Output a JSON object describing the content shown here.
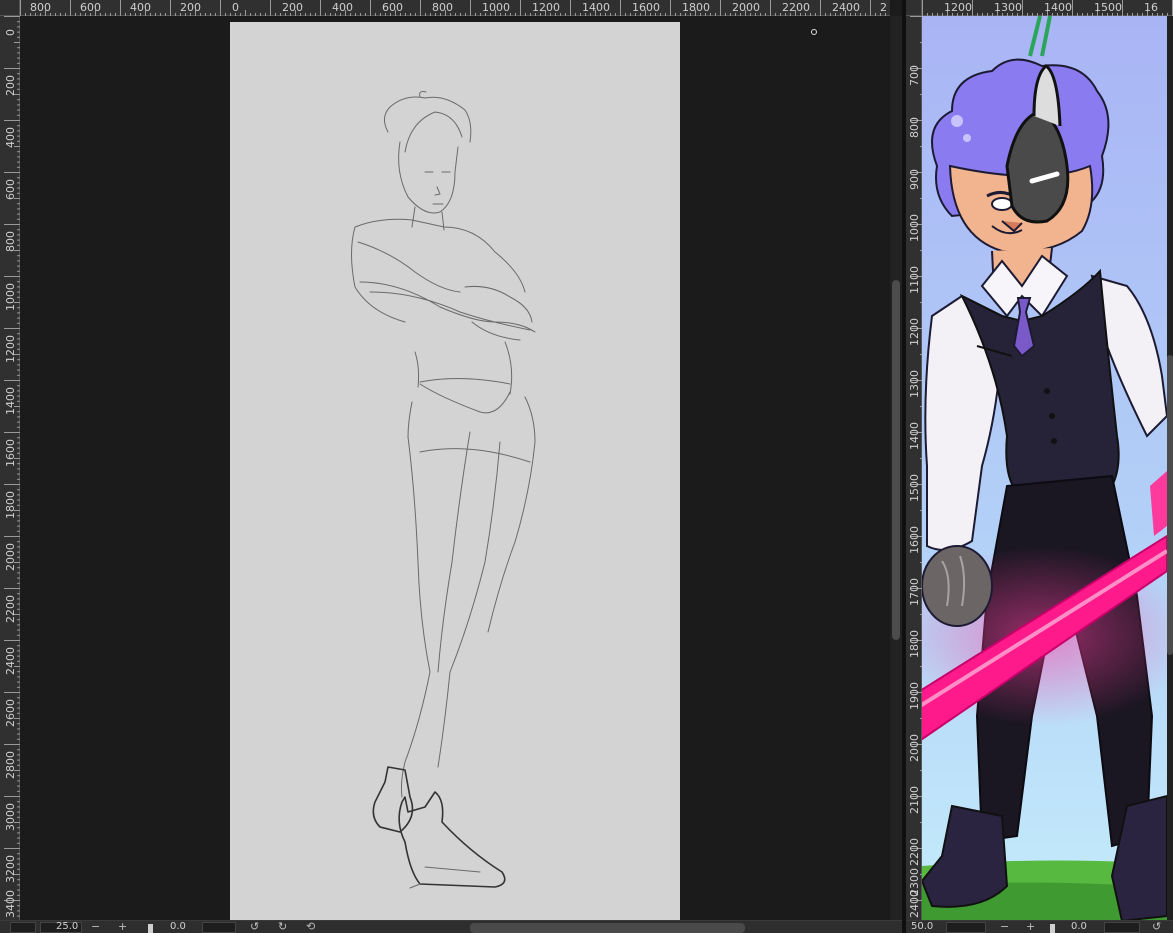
{
  "left_view": {
    "ruler_h_labels": [
      "800",
      "600",
      "400",
      "200",
      "0",
      "200",
      "400",
      "600",
      "800",
      "1000",
      "1200",
      "1400",
      "1600",
      "1800",
      "2000",
      "2200",
      "2400",
      "2"
    ],
    "ruler_v_labels": [
      "0",
      "200",
      "400",
      "600",
      "800",
      "1000",
      "1200",
      "1400",
      "1600",
      "1800",
      "2000",
      "2200",
      "2400",
      "2600",
      "2800",
      "3000",
      "3200",
      "3400"
    ],
    "bottom_bar": {
      "zoom_value": "25.0",
      "zoom_minus": "−",
      "zoom_plus": "+",
      "rotation_value": "0.0"
    }
  },
  "right_view": {
    "ruler_h_labels": [
      "1200",
      "1300",
      "1400",
      "1500",
      "16"
    ],
    "ruler_v_labels": [
      "700",
      "800",
      "900",
      "1000",
      "1100",
      "1200",
      "1300",
      "1400",
      "1500",
      "1600",
      "1700",
      "1800",
      "1900",
      "2000",
      "2100",
      "2200",
      "2300",
      "2400"
    ],
    "bottom_bar": {
      "zoom_value": "50.0",
      "zoom_minus": "−",
      "zoom_plus": "+",
      "rotation_value": "0.0"
    }
  },
  "icons": {
    "rotate_left": "rotate-left-icon",
    "rotate_right": "rotate-right-icon",
    "reset_view": "reset-view-icon"
  },
  "colors": {
    "app_bg": "#1b1b1b",
    "paper": "#d3d3d3",
    "sky": "#aebcf5",
    "grass": "#58b940",
    "saber": "#ff1a8c",
    "vest": "#262338",
    "hair": "#8a7cf0"
  }
}
